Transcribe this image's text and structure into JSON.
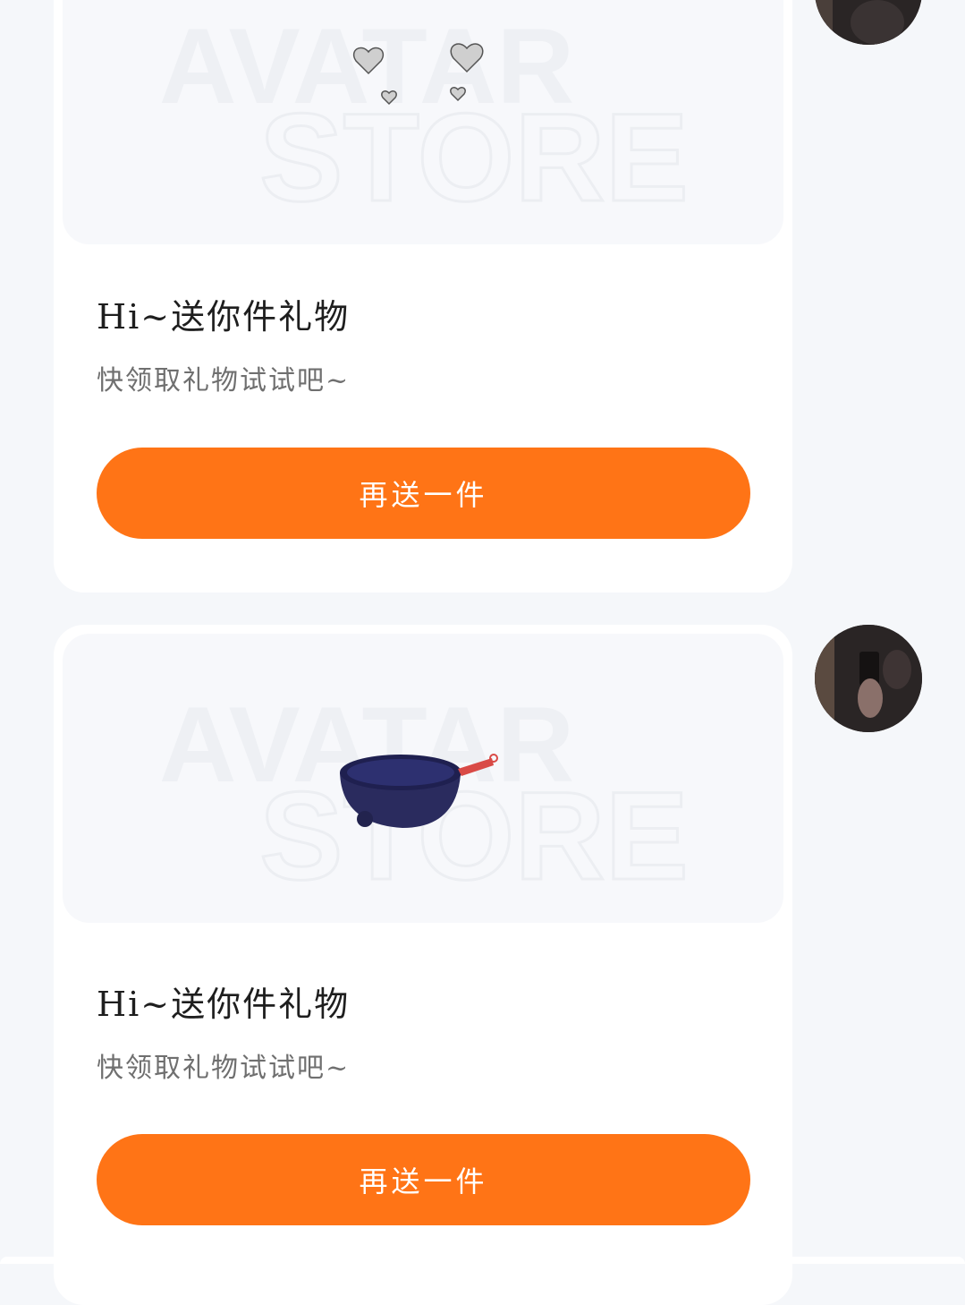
{
  "watermark": {
    "line1": "AVATAR",
    "line2": "STORE"
  },
  "messages": [
    {
      "gift_icon": "floating-hearts-icon",
      "title": "Hi~送你件礼物",
      "subtitle": "快领取礼物试试吧~",
      "button_label": "再送一件"
    },
    {
      "gift_icon": "wok-pan-icon",
      "title": "Hi~送你件礼物",
      "subtitle": "快领取礼物试试吧~",
      "button_label": "再送一件"
    }
  ],
  "colors": {
    "accent": "#ff7416",
    "card": "#ffffff",
    "background": "#f5f7fa"
  }
}
